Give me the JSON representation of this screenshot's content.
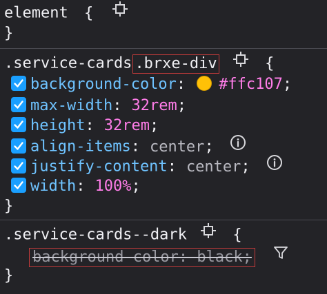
{
  "rules": [
    {
      "selector": "element",
      "open": "{",
      "close": "}",
      "declarations": []
    },
    {
      "selector_prefix": ".service-cards",
      "selector_boxed": ".brxe-div",
      "open": "{",
      "close": "}",
      "declarations": [
        {
          "property": "background-color",
          "colon": ":",
          "value": "#ffc107",
          "semicolon": ";",
          "swatch_color": "#ffc107",
          "checked": true
        },
        {
          "property": "max-width",
          "colon": ":",
          "value": "32rem",
          "semicolon": ";",
          "checked": true
        },
        {
          "property": "height",
          "colon": ":",
          "value": "32rem",
          "semicolon": ";",
          "checked": true
        },
        {
          "property": "align-items",
          "colon": ":",
          "value": "center",
          "semicolon": ";",
          "checked": true,
          "info_icon": "info-icon"
        },
        {
          "property": "justify-content",
          "colon": ":",
          "value": "center",
          "semicolon": ";",
          "checked": true,
          "info_icon": "info-icon"
        },
        {
          "property": "width",
          "colon": ":",
          "value": "100%",
          "semicolon": ";",
          "checked": true
        }
      ]
    },
    {
      "selector": ".service-cards--dark",
      "open": "{",
      "close": "}",
      "declarations": [
        {
          "text": "background-color: black;",
          "overridden": true,
          "filter_icon": "filter-icon"
        }
      ]
    }
  ],
  "colors": {
    "background": "#232327",
    "property": "#6fc3ff",
    "value": "#ff7de9",
    "keyword": "#b8b8c0",
    "checkbox": "#1a9fff",
    "highlight_border": "#c43b3b"
  },
  "icons": {
    "selector_locator": "crosshair-icon",
    "checkbox_mark": "checkmark-icon"
  }
}
